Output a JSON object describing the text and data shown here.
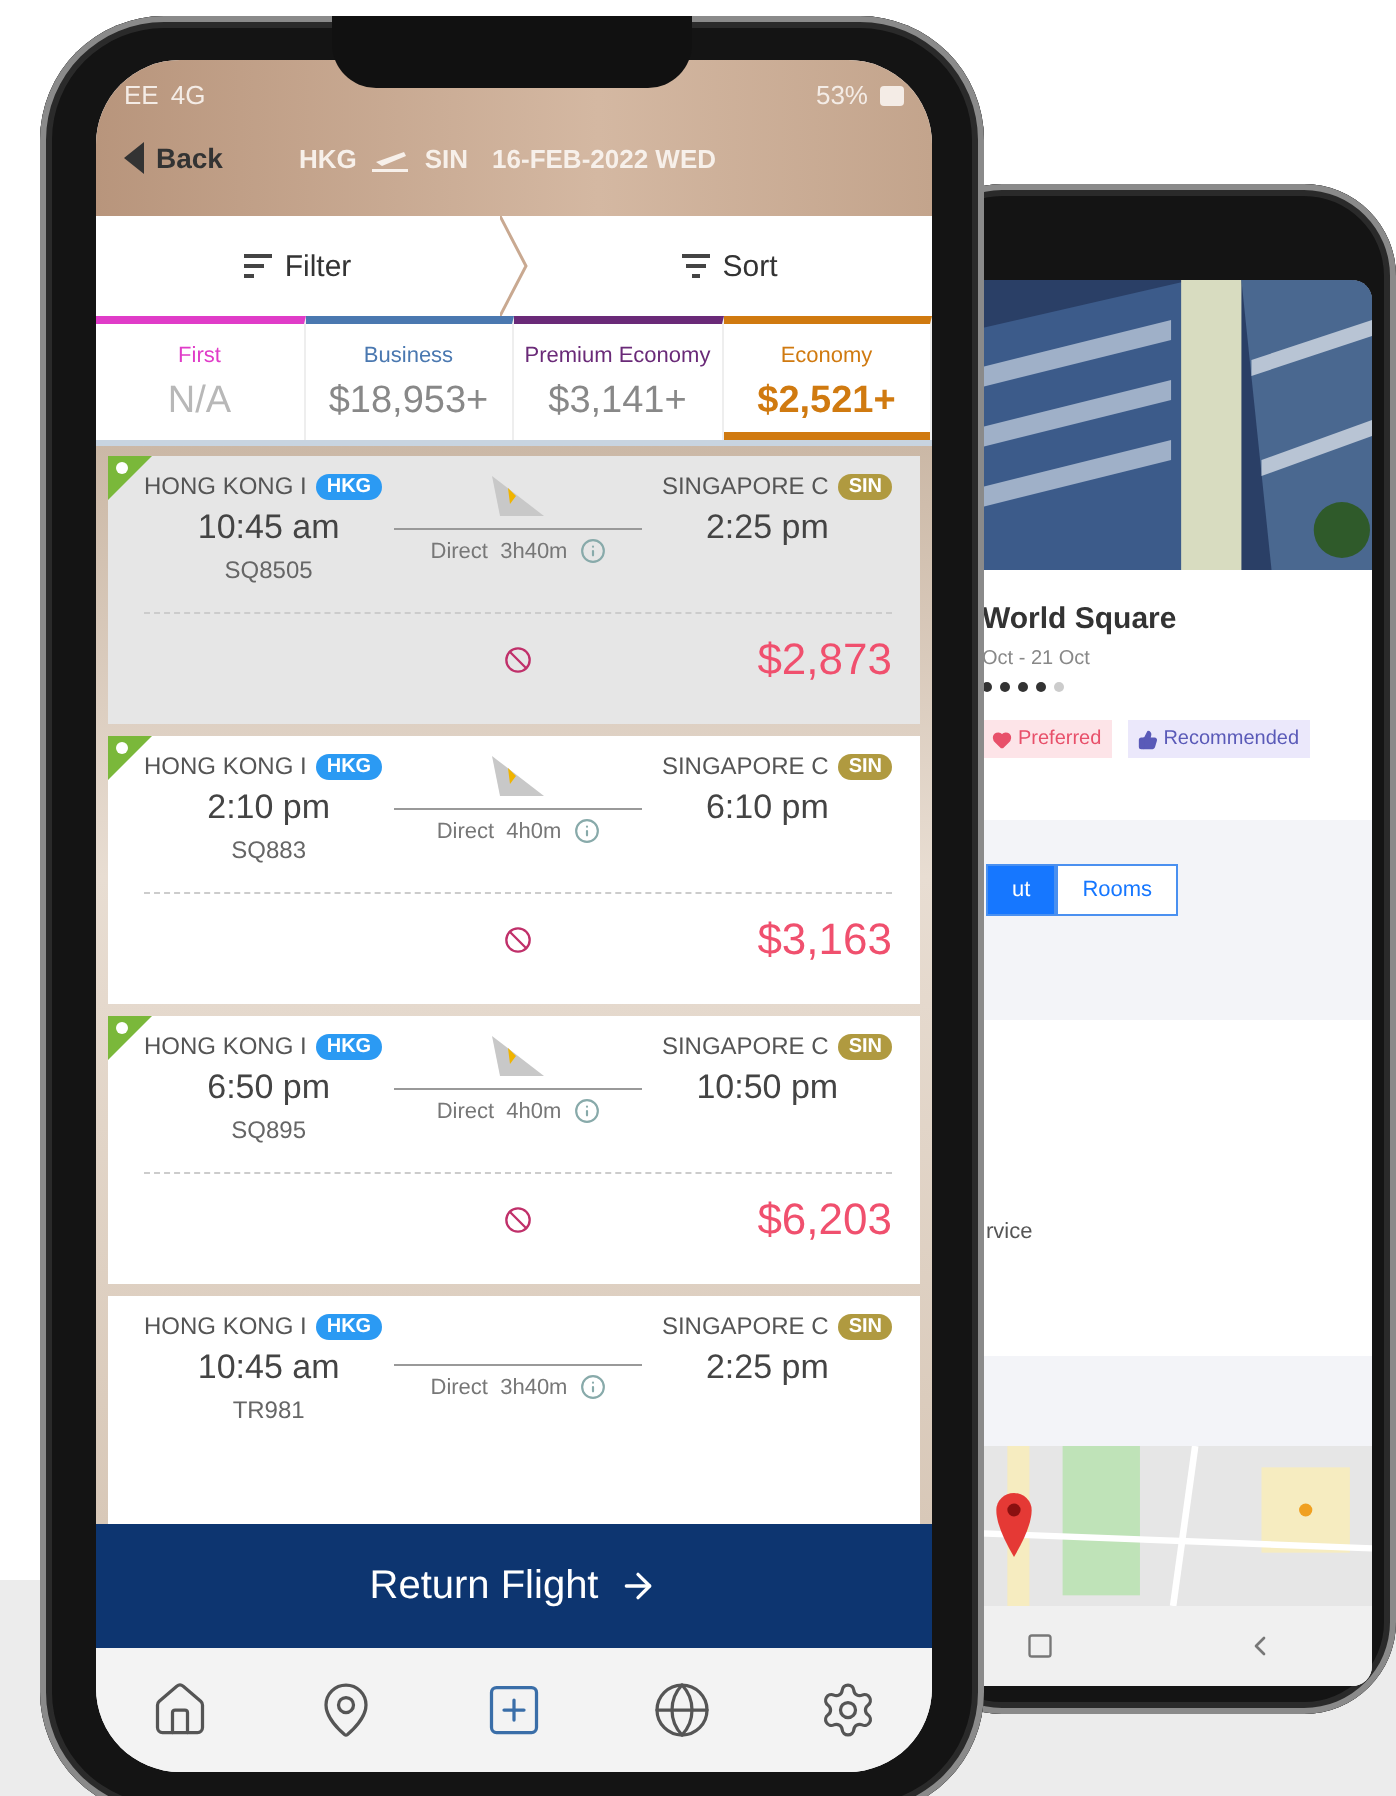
{
  "flight_app": {
    "status_bar": {
      "carrier": "EE",
      "network": "4G",
      "battery": "53%"
    },
    "header": {
      "back": "Back",
      "origin": "HKG",
      "destination": "SIN",
      "date": "16-FEB-2022 WED"
    },
    "toolbar": {
      "filter": "Filter",
      "sort": "Sort"
    },
    "cabins": [
      {
        "name": "First",
        "price": "N/A",
        "color": "#e03cc8",
        "available": false,
        "selected": false
      },
      {
        "name": "Business",
        "price": "$18,953+",
        "color": "#4a78b0",
        "available": true,
        "selected": false
      },
      {
        "name": "Premium Economy",
        "price": "$3,141+",
        "color": "#6a2a78",
        "available": true,
        "selected": false
      },
      {
        "name": "Economy",
        "price": "$2,521+",
        "color": "#d07a10",
        "available": true,
        "selected": true
      }
    ],
    "flights": [
      {
        "origin_city": "HONG KONG I",
        "origin_code": "HKG",
        "dest_city": "SINGAPORE C",
        "dest_code": "SIN",
        "depart": "10:45 am",
        "flight_no": "SQ8505",
        "duration": "Direct  3h40m",
        "arrive": "2:25 pm",
        "price": "$2,873",
        "selected": true,
        "favorite": true,
        "logo": true
      },
      {
        "origin_city": "HONG KONG I",
        "origin_code": "HKG",
        "dest_city": "SINGAPORE C",
        "dest_code": "SIN",
        "depart": "2:10 pm",
        "flight_no": "SQ883",
        "duration": "Direct  4h0m",
        "arrive": "6:10 pm",
        "price": "$3,163",
        "selected": false,
        "favorite": true,
        "logo": true
      },
      {
        "origin_city": "HONG KONG I",
        "origin_code": "HKG",
        "dest_city": "SINGAPORE C",
        "dest_code": "SIN",
        "depart": "6:50 pm",
        "flight_no": "SQ895",
        "duration": "Direct  4h0m",
        "arrive": "10:50 pm",
        "price": "$6,203",
        "selected": false,
        "favorite": true,
        "logo": true
      },
      {
        "origin_city": "HONG KONG I",
        "origin_code": "HKG",
        "dest_city": "SINGAPORE C",
        "dest_code": "SIN",
        "depart": "10:45 am",
        "flight_no": "TR981",
        "duration": "Direct  3h40m",
        "arrive": "2:25 pm",
        "selected": false,
        "favorite": false,
        "logo": false
      }
    ],
    "return_button": "Return Flight"
  },
  "hotel_app": {
    "title": "World Square",
    "dates": "Oct - 21 Oct",
    "stars": 4,
    "tags": [
      {
        "kind": "preferred",
        "label": "Preferred"
      },
      {
        "kind": "recommended",
        "label": "Recommended"
      }
    ],
    "tabs": [
      {
        "label": "ut",
        "selected": true
      },
      {
        "label": "Rooms",
        "selected": false
      }
    ],
    "text": "rvice"
  }
}
